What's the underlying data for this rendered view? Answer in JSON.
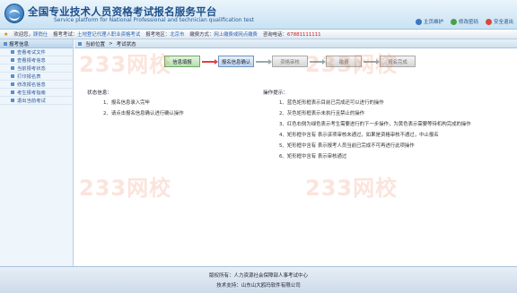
{
  "header": {
    "title_cn": "全国专业技术人员资格考试报名服务平台",
    "title_en": "Service platform for National Professional and technician qualification test",
    "links": [
      {
        "label": "主页维护",
        "icon": "home-icon",
        "color": "#3a78c2"
      },
      {
        "label": "修改密码",
        "icon": "key-icon",
        "color": "#4aa04a"
      },
      {
        "label": "安全退出",
        "icon": "exit-icon",
        "color": "#d84a3a"
      }
    ]
  },
  "infobar": {
    "welcome_label": "欢迎您，",
    "user": "顾俏仕",
    "exam_label": "报考考试：",
    "exam": "土地登记代理人职业资格考试",
    "area_label": "报考地区：",
    "area": "北京市",
    "pay_label": "缴费方式：",
    "pay": "网上缴费或网点缴费",
    "phone_label": "咨询电话：",
    "phone": "67881111111"
  },
  "sidebar": {
    "header": "报考信息",
    "items": [
      {
        "label": "查看考试文件"
      },
      {
        "label": "查看报考信息"
      },
      {
        "label": "当前报考状态"
      },
      {
        "label": "打印报名表"
      },
      {
        "label": "修改报名信息"
      },
      {
        "label": "考生报考指南"
      },
      {
        "label": "退出当前考试"
      }
    ]
  },
  "breadcrumb": {
    "home": "当前位置",
    "current": "考试状态"
  },
  "steps": [
    {
      "label": "信息填报",
      "state": "green"
    },
    {
      "label": "报名信息确认",
      "state": "blue"
    },
    {
      "label": "资格审核",
      "state": "gray"
    },
    {
      "label": "缴费",
      "state": "gray"
    },
    {
      "label": "报名完成",
      "state": "gray"
    }
  ],
  "status_panel": {
    "title": "状态信息：",
    "items": [
      "1、报名信息录入完毕",
      "2、请点击报名信息确认进行确认操作"
    ]
  },
  "tips_panel": {
    "title": "操作提示：",
    "items": [
      "1、蓝色矩形框表示目前已完成还可以进行的操作",
      "2、灰色矩形框表示未执行且禁止的操作",
      "3、红色右侧为绿色表示考生需要进行的下一步操作，为黄色表示需要等待机构完成的操作",
      "4、矩形框中含有 表示该项审核未通过，如果是资格审核不通过，中止报名",
      "5、矩形框中含有 表示报考人员当前已完成不可再进行此项操作",
      "6、矩形框中含有 表示审核通过"
    ]
  },
  "footer": {
    "line1": "版权所有：人力资源社会保障部人事考试中心",
    "line2": "技术支持：山东山大鸥玛软件有限公司"
  },
  "watermark": "233网校"
}
